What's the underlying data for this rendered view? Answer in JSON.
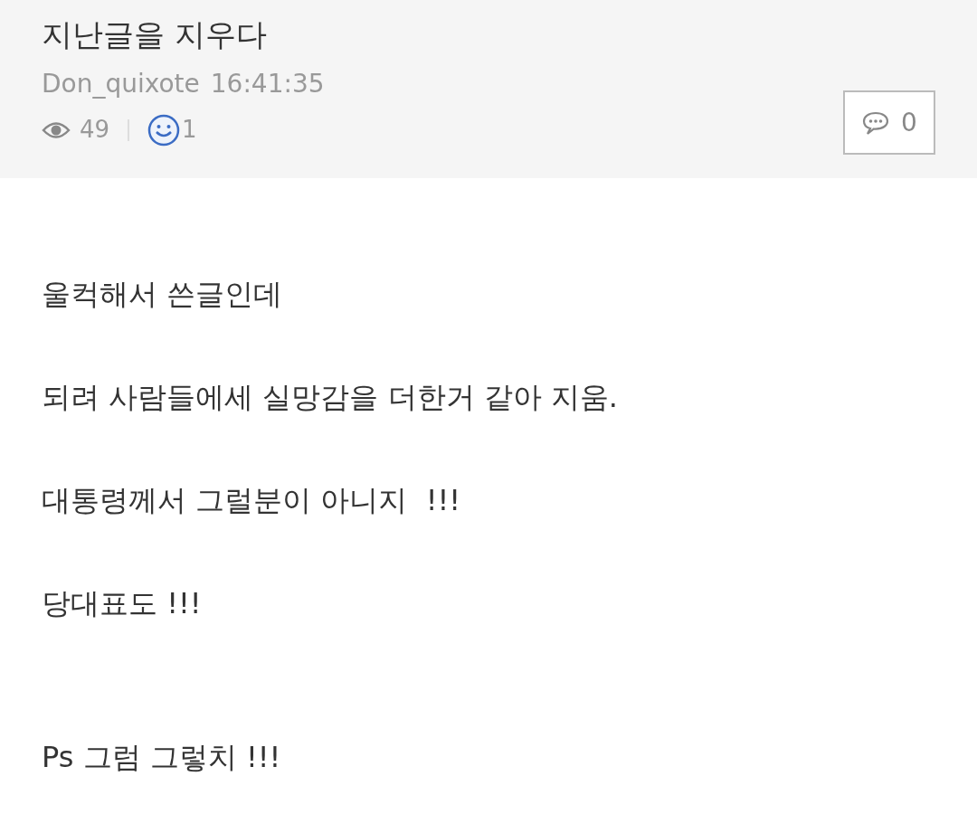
{
  "post": {
    "title": "지난글을 지우다",
    "author": "Don_quixote",
    "time": "16:41:35",
    "views": "49",
    "likes": "1",
    "comments": "0"
  },
  "body": [
    "울컥해서 쓴글인데",
    "되려 사람들에세 실망감을 더한거 같아 지움.",
    "대통령께서 그럴분이 아니지  !!!",
    "당대표도 !!!",
    "Ps 그럼 그렇치 !!!"
  ]
}
